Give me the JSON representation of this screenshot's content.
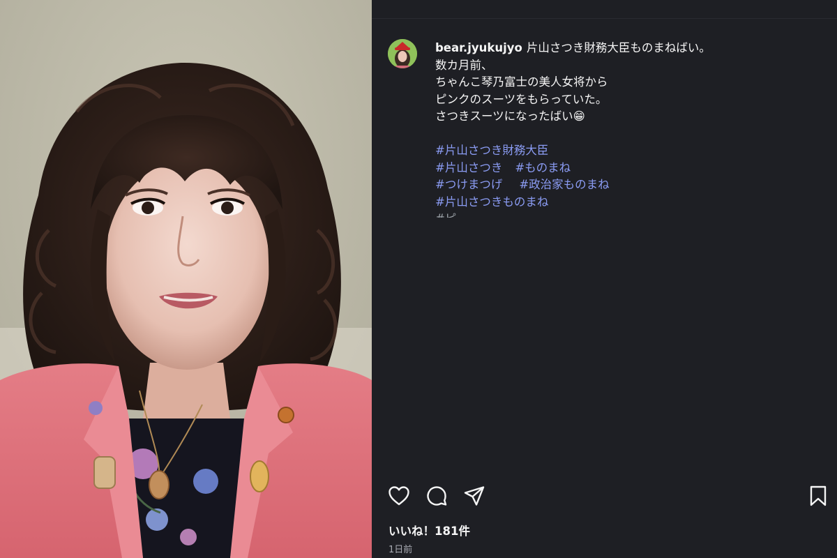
{
  "post": {
    "username": "bear.jyukujyo",
    "caption_lines": [
      "片山さつき財務大臣ものまねばい。",
      "数カ月前、",
      "ちゃんこ琴乃富士の美人女将から",
      "ピンクのスーツをもらっていた。",
      "さつきスーツになったばい😁"
    ],
    "hashtags": {
      "h1": "#片山さつき財務大臣",
      "h2": "#片山さつき",
      "h3": "#ものまね",
      "h4": "#つけまつげ",
      "h5": "#政治家ものまね",
      "h6": "#片山さつきものまね"
    },
    "truncated_line": "#ピ"
  },
  "actions": {
    "like": "heart-icon",
    "comment": "comment-icon",
    "share": "send-icon",
    "save": "bookmark-icon"
  },
  "stats": {
    "likes": "いいね！181件",
    "time": "1日前"
  },
  "colors": {
    "panel_bg": "#1e1f24",
    "hashtag": "#8b9cf4",
    "text": "#f5f5f5",
    "muted": "#a9abb3",
    "jacket": "#e0767e"
  }
}
